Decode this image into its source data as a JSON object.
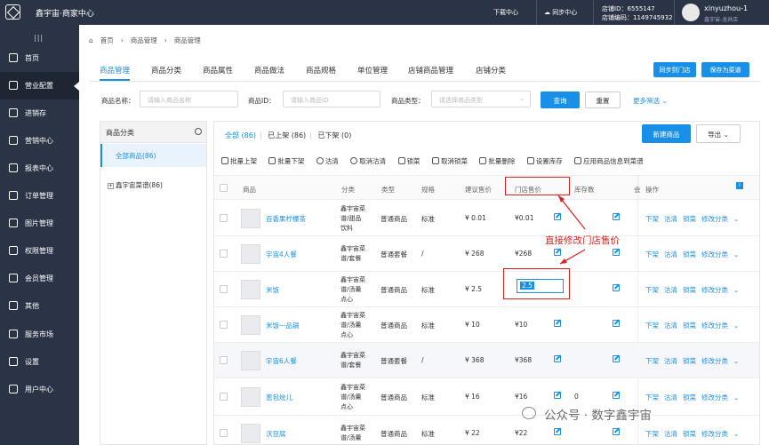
{
  "app": {
    "brand": "鑫宇宙·商家中心",
    "download": "下载中心",
    "sync": "同步中心",
    "store_id_label": "店铺ID：6555147",
    "store_code_label": "店铺编码：1149745932",
    "user": "xinyuzhou-1",
    "store_name": "鑫宇宙-龙井店"
  },
  "sidebar": {
    "toggle": "|||",
    "items": [
      {
        "label": "首页",
        "icon": "home-icon"
      },
      {
        "label": "营业配置",
        "icon": "shop-icon"
      },
      {
        "label": "进销存",
        "icon": "inventory-icon"
      },
      {
        "label": "营销中心",
        "icon": "marketing-icon"
      },
      {
        "label": "报表中心",
        "icon": "report-icon"
      },
      {
        "label": "订单管理",
        "icon": "order-icon"
      },
      {
        "label": "图片管理",
        "icon": "image-icon"
      },
      {
        "label": "权限管理",
        "icon": "permission-icon"
      },
      {
        "label": "会员管理",
        "icon": "member-icon"
      },
      {
        "label": "其他",
        "icon": "other-icon"
      },
      {
        "label": "服务市场",
        "icon": "market-icon"
      },
      {
        "label": "设置",
        "icon": "settings-icon"
      },
      {
        "label": "用户中心",
        "icon": "user-center-icon"
      }
    ]
  },
  "breadcrumb": [
    "首页",
    "商品管理",
    "商品管理"
  ],
  "tabs": [
    "商品管理",
    "商品分类",
    "商品属性",
    "商品做法",
    "商品规格",
    "单位管理",
    "店铺商品管理",
    "店铺分类"
  ],
  "actions": {
    "sync": "同步到门店",
    "save": "保存为菜谱"
  },
  "filters": {
    "name_label": "商品名称：",
    "name_placeholder": "请输入商品名称",
    "id_label": "商品ID：",
    "id_placeholder": "请输入商品ID",
    "type_label": "商品类型：",
    "type_placeholder": "请选择商品类型",
    "query": "查询",
    "reset": "重置",
    "more": "更多筛选"
  },
  "left": {
    "title": "商品分类",
    "all": "全部商品(86)",
    "cat": "鑫宇宙菜谱(86)"
  },
  "status": {
    "all": "全部 (86)",
    "on": "已上架 (86)",
    "off": "已下架 (0)",
    "new": "新建商品",
    "export": "导出"
  },
  "toolbar": [
    "批量上架",
    "批量下架",
    "沽清",
    "取消沽清",
    "锁菜",
    "取消锁菜",
    "批量删除",
    "设置库存",
    "应用商品信息到菜谱"
  ],
  "columns": [
    "商品",
    "分类",
    "类型",
    "规格",
    "建议售价",
    "门店售价",
    "库存数",
    "会",
    "操作"
  ],
  "rows": [
    {
      "name": "百香果柠檬茶",
      "cat": [
        "鑫宇宙菜",
        "谱/甜品",
        "饮料"
      ],
      "type": "普通商品",
      "spec": "标准",
      "price": "¥ 0.01",
      "store_price": "¥0.01",
      "stock": "",
      "ops": [
        "下架",
        "沽清",
        "锁菜",
        "修改分类"
      ]
    },
    {
      "name": "宇宙4人餐",
      "cat": [
        "鑫宇宙菜",
        "谱/套餐"
      ],
      "type": "普通套餐",
      "spec": "/",
      "price": "¥ 268",
      "store_price": "¥268",
      "stock": "",
      "ops": [
        "下架",
        "沽清",
        "锁菜",
        "修改分类"
      ]
    },
    {
      "name": "米饭",
      "cat": [
        "鑫宇宙菜",
        "谱/汤羹",
        "点心"
      ],
      "type": "普通商品",
      "spec": "标准",
      "price": "¥ 2.5",
      "store_price": "2.5",
      "stock": "",
      "ops": [
        "下架",
        "沽清",
        "锁菜",
        "修改分类"
      ]
    },
    {
      "name": "米饭一品锅",
      "cat": [
        "鑫宇宙菜",
        "谱/汤羹",
        "点心"
      ],
      "type": "普通商品",
      "spec": "标准",
      "price": "¥ 10",
      "store_price": "¥10",
      "stock": "",
      "ops": [
        "下架",
        "沽清",
        "锁菜",
        "修改分类"
      ]
    },
    {
      "name": "宇宙6人餐",
      "cat": [
        "鑫宇宙菜",
        "谱/套餐"
      ],
      "type": "普通套餐",
      "spec": "/",
      "price": "¥ 368",
      "store_price": "¥368",
      "stock": "",
      "ops": [
        "下架",
        "沽清",
        "锁菜",
        "修改分类"
      ]
    },
    {
      "name": "葱包烩儿",
      "cat": [
        "鑫宇宙菜",
        "谱/汤羹",
        "点心"
      ],
      "type": "普通商品",
      "spec": "标准",
      "price": "¥ 16",
      "store_price": "¥16",
      "stock": "0",
      "ops": [
        "下架",
        "沽清",
        "锁菜",
        "修改分类"
      ]
    },
    {
      "name": "沃豆腐",
      "cat": [
        "鑫宇宙菜",
        "谱/汤羹"
      ],
      "type": "普通商品",
      "spec": "标准",
      "price": "¥ 22",
      "store_price": "¥22",
      "stock": "",
      "ops": [
        "下架",
        "沽清",
        "锁菜",
        "修改分类"
      ]
    }
  ],
  "annotation": "直接修改门店售价",
  "watermark": "公众号 · 数字鑫宇宙"
}
